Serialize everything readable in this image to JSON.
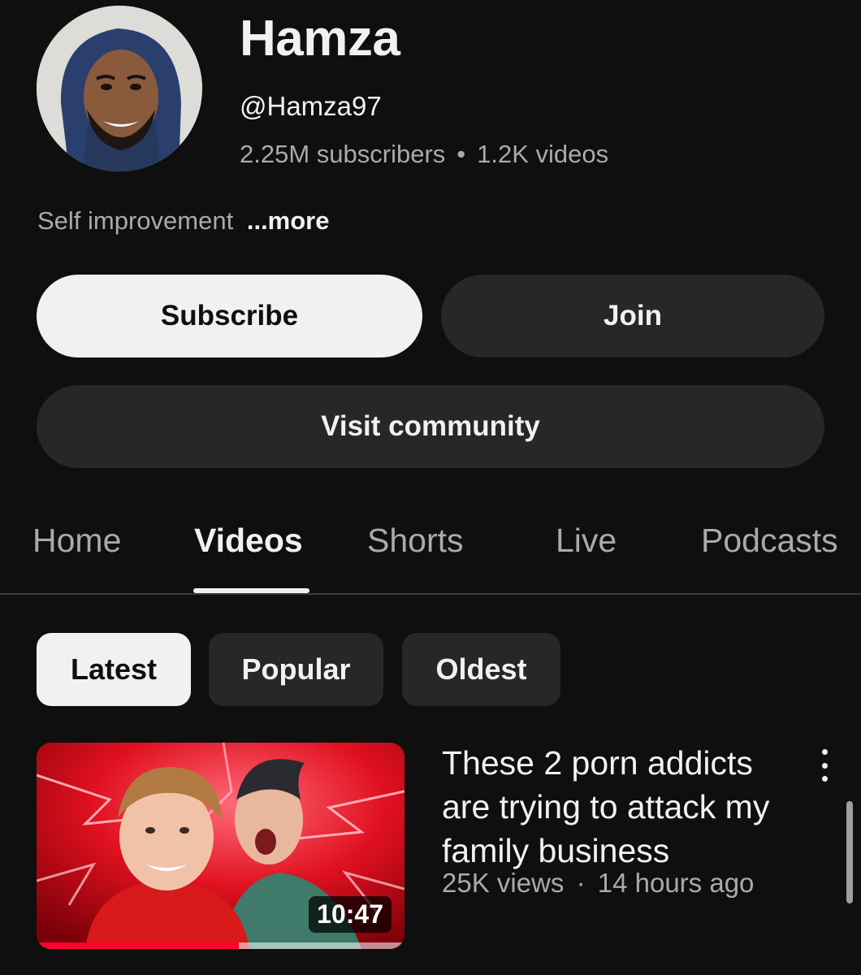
{
  "channel": {
    "name": "Hamza",
    "handle": "@Hamza97",
    "subscribers": "2.25M subscribers",
    "separator": "•",
    "videos": "1.2K videos",
    "description": "Self improvement",
    "more_label": "...more"
  },
  "actions": {
    "subscribe_label": "Subscribe",
    "join_label": "Join",
    "community_label": "Visit community"
  },
  "tabs": [
    {
      "label": "Home"
    },
    {
      "label": "Videos"
    },
    {
      "label": "Shorts"
    },
    {
      "label": "Live"
    },
    {
      "label": "Podcasts"
    }
  ],
  "active_tab": "Videos",
  "filters": [
    {
      "label": "Latest"
    },
    {
      "label": "Popular"
    },
    {
      "label": "Oldest"
    }
  ],
  "active_filter": "Latest",
  "videos": [
    {
      "title": "These 2 porn addicts are trying to attack my family business",
      "views": "25K views",
      "meta_separator": "·",
      "age": "14 hours ago",
      "duration": "10:47",
      "watch_progress": 0.55
    }
  ],
  "colors": {
    "background": "#0f0f0f",
    "surface": "#272727",
    "primary_text": "#f1f1f1",
    "secondary_text": "#aaaaaa",
    "progress_red": "#ff0033"
  },
  "icons": {
    "video_menu": "more-vertical-icon"
  }
}
